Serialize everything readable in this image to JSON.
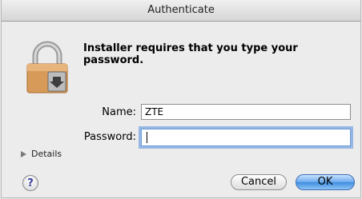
{
  "window": {
    "title": "Authenticate"
  },
  "dialog": {
    "message": "Installer requires that you type your password.",
    "name_label": "Name:",
    "name_value": "ZTE",
    "password_label": "Password:",
    "password_value": "",
    "details_label": "Details",
    "help_label": "?",
    "cancel_label": "Cancel",
    "ok_label": "OK"
  },
  "icons": {
    "lock": "lock-icon",
    "details": "disclosure-triangle-icon"
  },
  "colors": {
    "default_button": "#3f8de0",
    "focus_ring": "#6f9ad8"
  }
}
